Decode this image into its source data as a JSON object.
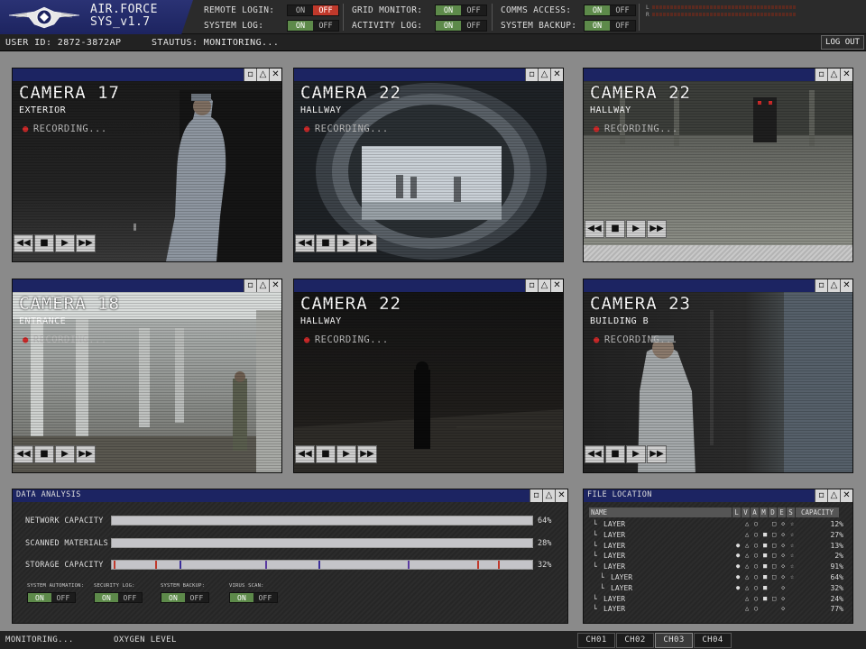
{
  "app": {
    "title_line1": "AIR.FORCE",
    "title_line2": "SYS_v1.7"
  },
  "toggles": {
    "remote_login": {
      "label": "REMOTE LOGIN:",
      "on": "ON",
      "off": "OFF",
      "state": "off"
    },
    "system_log": {
      "label": "SYSTEM LOG:",
      "on": "ON",
      "off": "OFF",
      "state": "on"
    },
    "grid_monitor": {
      "label": "GRID MONITOR:",
      "on": "ON",
      "off": "OFF",
      "state": "on"
    },
    "activity_log": {
      "label": "ACTIVITY LOG:",
      "on": "ON",
      "off": "OFF",
      "state": "on"
    },
    "comms_access": {
      "label": "COMMS ACCESS:",
      "on": "ON",
      "off": "OFF",
      "state": "on"
    },
    "system_backup": {
      "label": "SYSTEM BACKUP:",
      "on": "ON",
      "off": "OFF",
      "state": "on"
    }
  },
  "meter": {
    "left_label": "L",
    "right_label": "R"
  },
  "status": {
    "user_id": "USER ID: 2872-3872AP",
    "status_text": "STAUTUS: MONITORING...",
    "logout": "LOG OUT"
  },
  "cameras": [
    {
      "title": "CAMERA 17",
      "location": "EXTERIOR",
      "rec": "RECORDING..."
    },
    {
      "title": "CAMERA 22",
      "location": "HALLWAY",
      "rec": "RECORDING..."
    },
    {
      "title": "CAMERA 22",
      "location": "HALLWAY",
      "rec": "RECORDING..."
    },
    {
      "title": "CAMERA 18",
      "location": "ENTRANCE",
      "rec": "RECORDING..."
    },
    {
      "title": "CAMERA 22",
      "location": "HALLWAY",
      "rec": "RECORDING..."
    },
    {
      "title": "CAMERA 23",
      "location": "BUILDING B",
      "rec": "RECORDING..."
    }
  ],
  "data_analysis": {
    "title": "DATA ANALYSIS",
    "rows": [
      {
        "label": "NETWORK CAPACITY",
        "pct": "64%"
      },
      {
        "label": "SCANNED MATERIALS",
        "pct": "28%"
      },
      {
        "label": "STORAGE CAPACITY",
        "pct": "32%"
      }
    ],
    "mini_toggles": [
      {
        "label": "SYSTEM AUTOMATION:",
        "on": "ON",
        "off": "OFF"
      },
      {
        "label": "SECURITY LOG:",
        "on": "ON",
        "off": "OFF"
      },
      {
        "label": "SYSTEM BACKUP:",
        "on": "ON",
        "off": "OFF"
      },
      {
        "label": "VIRUS SCAN:",
        "on": "ON",
        "off": "OFF"
      }
    ]
  },
  "file_location": {
    "title": "FILE LOCATION",
    "columns": [
      "NAME",
      "L",
      "V",
      "A",
      "M",
      "D",
      "E",
      "S",
      "CAPACITY"
    ],
    "rows": [
      {
        "indent": 0,
        "name": "LAYER",
        "l": "",
        "v": "△",
        "a": "○",
        "m": "",
        "d": "□",
        "e": "◇",
        "s": "☆",
        "cap": "12%"
      },
      {
        "indent": 0,
        "name": "LAYER",
        "l": "",
        "v": "△",
        "a": "○",
        "m": "■",
        "d": "□",
        "e": "◇",
        "s": "☆",
        "cap": "27%"
      },
      {
        "indent": 0,
        "name": "LAYER",
        "l": "●",
        "v": "△",
        "a": "○",
        "m": "■",
        "d": "□",
        "e": "◇",
        "s": "☆",
        "cap": "13%"
      },
      {
        "indent": 0,
        "name": "LAYER",
        "l": "●",
        "v": "△",
        "a": "○",
        "m": "■",
        "d": "□",
        "e": "◇",
        "s": "☆",
        "cap": "2%"
      },
      {
        "indent": 0,
        "name": "LAYER",
        "l": "●",
        "v": "△",
        "a": "○",
        "m": "■",
        "d": "□",
        "e": "◇",
        "s": "☆",
        "cap": "91%"
      },
      {
        "indent": 1,
        "name": "LAYER",
        "l": "●",
        "v": "△",
        "a": "○",
        "m": "■",
        "d": "□",
        "e": "◇",
        "s": "☆",
        "cap": "64%"
      },
      {
        "indent": 1,
        "name": "LAYER",
        "l": "●",
        "v": "△",
        "a": "○",
        "m": "■",
        "d": "",
        "e": "◇",
        "s": "",
        "cap": "32%"
      },
      {
        "indent": 0,
        "name": "LAYER",
        "l": "",
        "v": "△",
        "a": "○",
        "m": "■",
        "d": "□",
        "e": "◇",
        "s": "",
        "cap": "24%"
      },
      {
        "indent": 0,
        "name": "LAYER",
        "l": "",
        "v": "△",
        "a": "○",
        "m": "",
        "d": "",
        "e": "◇",
        "s": "",
        "cap": "77%"
      }
    ]
  },
  "footer": {
    "monitoring": "MONITORING...",
    "oxygen": "OXYGEN LEVEL",
    "channels": [
      "CH01",
      "CH02",
      "CH03",
      "CH04"
    ],
    "active_channel": "CH03"
  },
  "colors": {
    "accent_navy": "#1c2462",
    "on_green": "#5d8a4a",
    "off_red": "#c0392b",
    "rec_red": "#d02a2a"
  }
}
